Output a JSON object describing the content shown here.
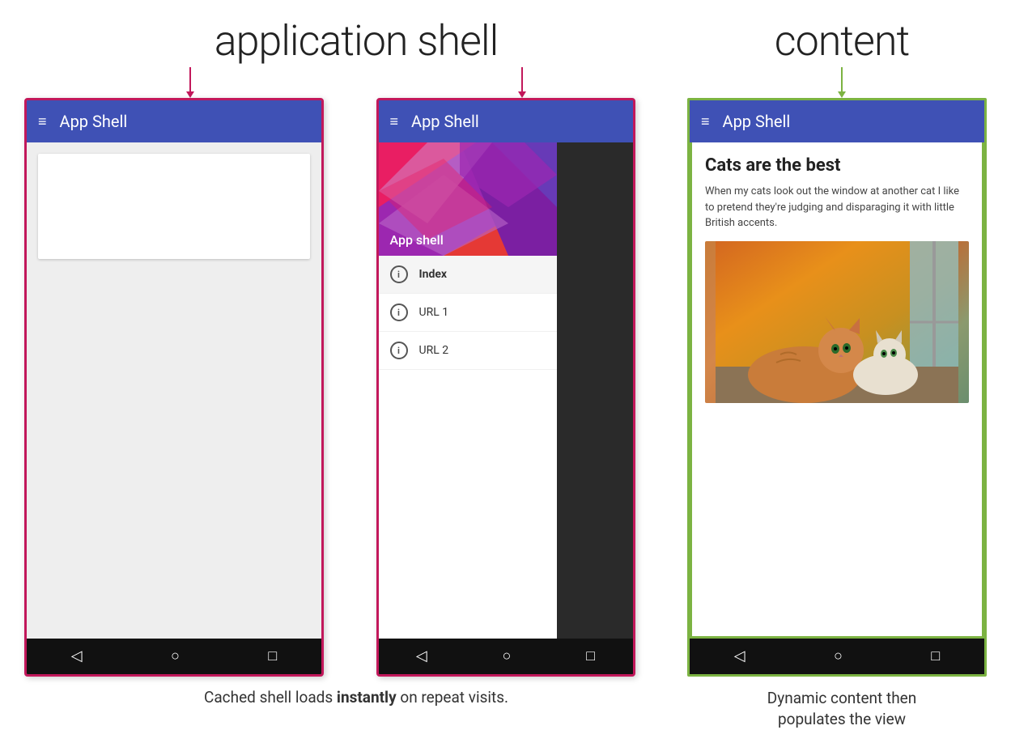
{
  "labels": {
    "app_shell": "application shell",
    "content": "content"
  },
  "phone1": {
    "app_bar_title": "App Shell",
    "border_color": "#c2185b"
  },
  "phone2": {
    "app_bar_title": "App Shell",
    "drawer_header_label": "App shell",
    "drawer_items": [
      {
        "label": "Index",
        "active": true
      },
      {
        "label": "URL 1",
        "active": false
      },
      {
        "label": "URL 2",
        "active": false
      }
    ]
  },
  "phone3": {
    "app_bar_title": "App Shell",
    "content_title": "Cats are the best",
    "content_text": "When my cats look out the window at another cat I like to pretend they're judging and disparaging it with little British accents.",
    "border_color": "#7cb342"
  },
  "nav": {
    "back": "◁",
    "home": "○",
    "recent": "□"
  },
  "bottom_text_left": "Cached shell loads instantly on repeat visits.",
  "bottom_text_left_bold": "instantly",
  "bottom_text_right": "Dynamic content then\npopulates the view"
}
